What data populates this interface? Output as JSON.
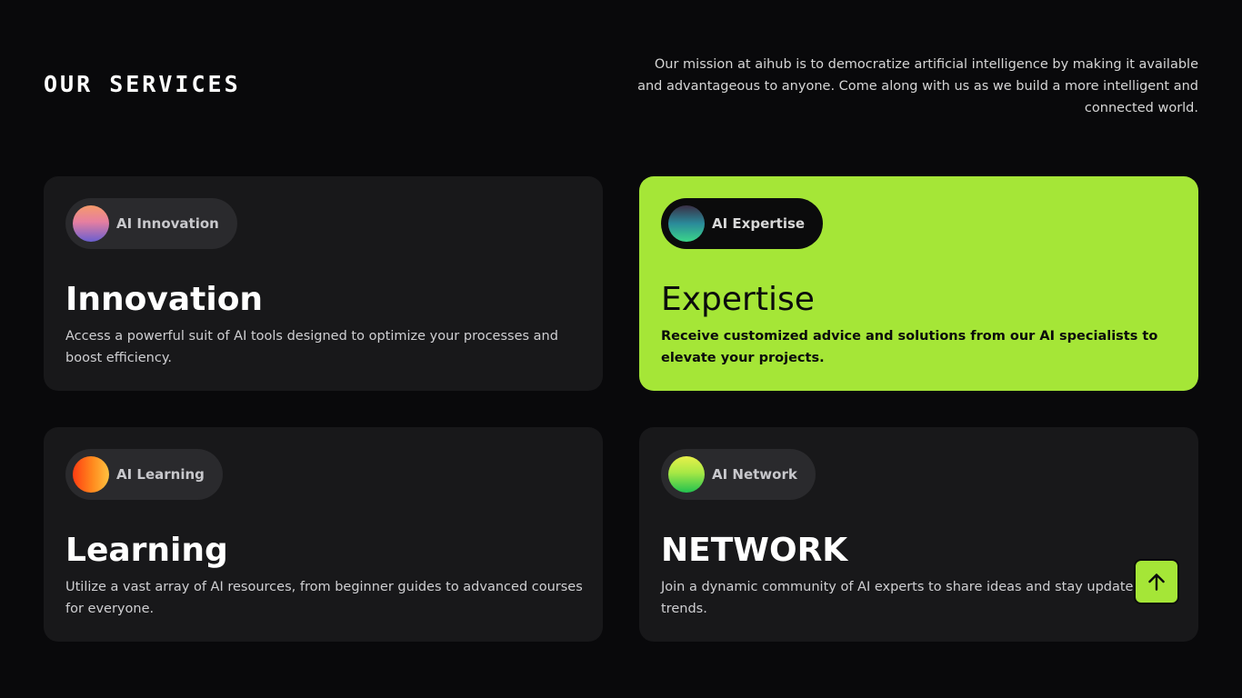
{
  "section": {
    "title": "OUR SERVICES",
    "mission": "Our mission at aihub is to democratize artificial intelligence by making it available and advantageous to anyone. Come along with us as we build a more intelligent and connected world."
  },
  "cards": [
    {
      "pill_label": "AI Innovation",
      "title": "Innovation",
      "description": "Access a powerful suit of AI tools designed to optimize your processes and boost efficiency."
    },
    {
      "pill_label": "AI Expertise",
      "title": "Expertise",
      "description": "Receive customized advice and solutions from our AI specialists to elevate your projects."
    },
    {
      "pill_label": "AI Learning",
      "title": "Learning",
      "description": "Utilize a vast array of AI resources, from beginner guides to advanced courses for everyone."
    },
    {
      "pill_label": "AI Network",
      "title": "NETWORK",
      "description": "Join a dynamic community of AI experts to share ideas and stay updated on trends."
    }
  ],
  "scroll_top": {
    "icon": "arrow-up-icon"
  },
  "colors": {
    "background": "#09090b",
    "card": "#18181a",
    "accent": "#a5e637"
  }
}
